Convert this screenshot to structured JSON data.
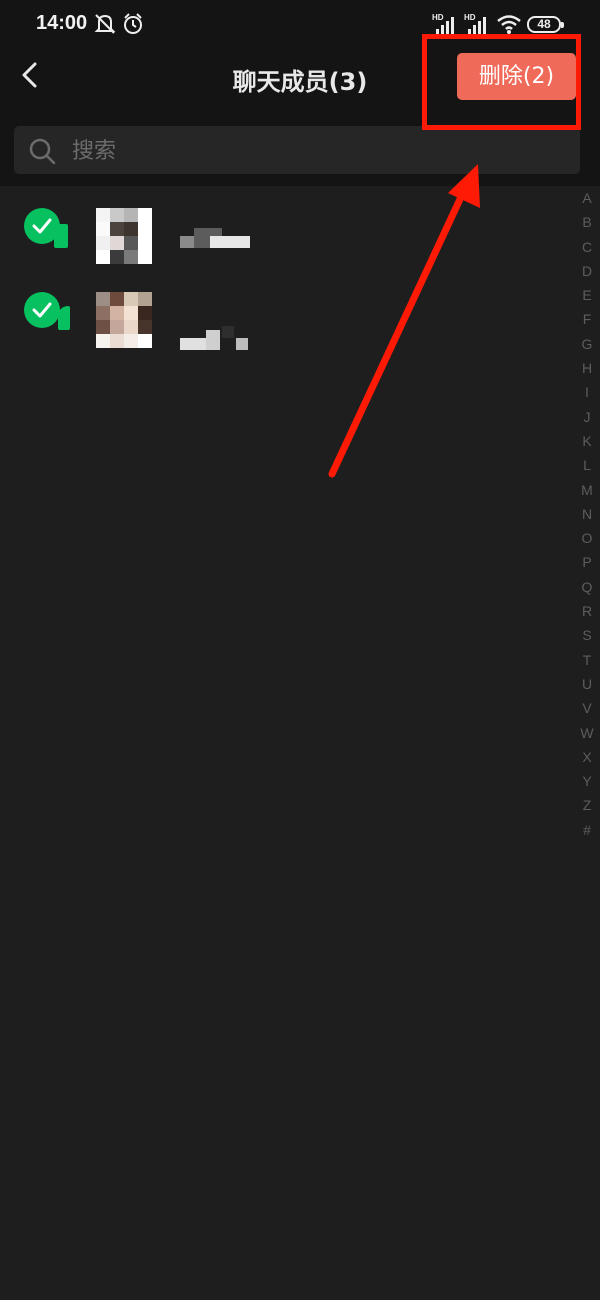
{
  "status_bar": {
    "time": "14:00",
    "battery": "48",
    "icons": [
      "mute-bell-icon",
      "alarm-icon",
      "hd-signal-icon",
      "hd-signal-icon",
      "wifi-icon",
      "battery-icon"
    ]
  },
  "header": {
    "title": "聊天成员(3)",
    "delete_button": "删除(2)",
    "back_icon": "chevron-left-icon"
  },
  "search": {
    "placeholder": "搜索"
  },
  "members": [
    {
      "selected": true
    },
    {
      "selected": true
    }
  ],
  "alphabet_index": [
    "A",
    "B",
    "C",
    "D",
    "E",
    "F",
    "G",
    "H",
    "I",
    "J",
    "K",
    "L",
    "M",
    "N",
    "O",
    "P",
    "Q",
    "R",
    "S",
    "T",
    "U",
    "V",
    "W",
    "X",
    "Y",
    "Z",
    "#"
  ],
  "colors": {
    "background": "#1e1e1e",
    "header_bg": "#141414",
    "delete_button": "#f06a5a",
    "check_green": "#07c160",
    "annotation_red": "#ff1a06"
  }
}
